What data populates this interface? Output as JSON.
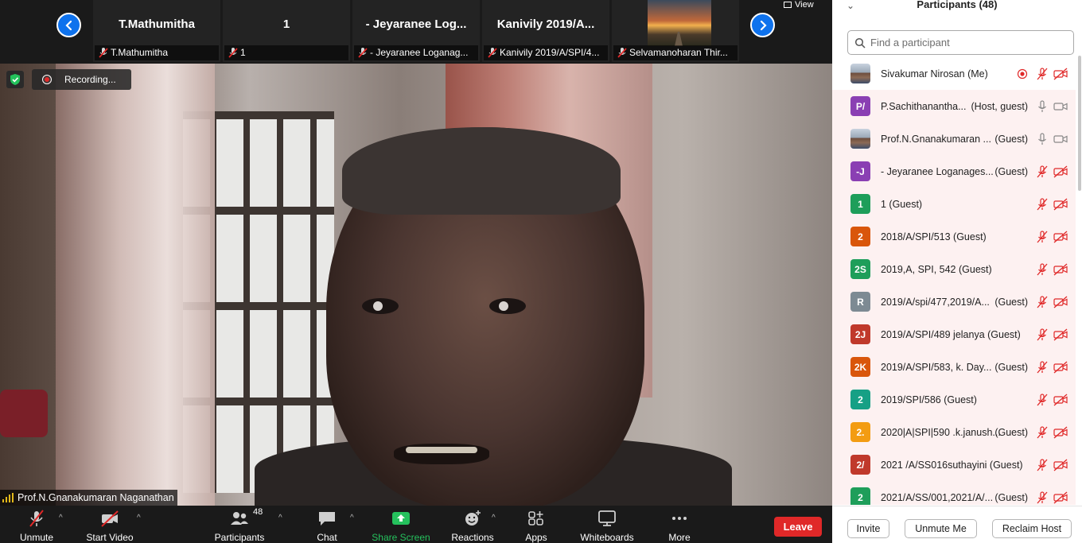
{
  "strip": {
    "tiles": [
      {
        "name": "T.Mathumitha",
        "label": "T.Mathumitha"
      },
      {
        "name": "1",
        "label": "1"
      },
      {
        "name": "- Jeyaranee Log...",
        "label": "- Jeyaranee Loganag..."
      },
      {
        "name": "Kanivily 2019/A...",
        "label": "Kanivily 2019/A/SPI/4..."
      },
      {
        "name": "",
        "label": "Selvamanoharan Thir..."
      }
    ],
    "view_label": "View"
  },
  "video": {
    "recording_label": "Recording...",
    "speaker_name": "Prof.N.Gnanakumaran Naganathan"
  },
  "toolbar": {
    "unmute": "Unmute",
    "start_video": "Start Video",
    "participants": "Participants",
    "participants_count": "48",
    "chat": "Chat",
    "share_screen": "Share Screen",
    "reactions": "Reactions",
    "apps": "Apps",
    "whiteboards": "Whiteboards",
    "more": "More",
    "leave": "Leave"
  },
  "panel": {
    "title": "Participants (48)",
    "search_placeholder": "Find a participant",
    "participants": [
      {
        "initials": "",
        "name": "Sivakumar Nirosan (Me)",
        "role": "",
        "color": "photo",
        "mic": "muted",
        "video": "off",
        "recording": true
      },
      {
        "initials": "P/",
        "name": "P.Sachithanantha...",
        "role": "(Host, guest)",
        "color": "#8a3fb3",
        "mic": "on",
        "video": "on"
      },
      {
        "initials": "",
        "name": "Prof.N.Gnanakumaran ...",
        "role": "(Guest)",
        "color": "photo",
        "mic": "on",
        "video": "on"
      },
      {
        "initials": "-J",
        "name": "- Jeyaranee Loganages...",
        "role": "(Guest)",
        "color": "#8a3fb3",
        "mic": "muted",
        "video": "off"
      },
      {
        "initials": "1",
        "name": "1 (Guest)",
        "role": "",
        "color": "#1e9e5a",
        "mic": "muted",
        "video": "off"
      },
      {
        "initials": "2",
        "name": "2018/A/SPI/513 (Guest)",
        "role": "",
        "color": "#d9560b",
        "mic": "muted",
        "video": "off"
      },
      {
        "initials": "2S",
        "name": "2019,A, SPI, 542 (Guest)",
        "role": "",
        "color": "#1e9e5a",
        "mic": "muted",
        "video": "off"
      },
      {
        "initials": "R",
        "name": "2019/A/spi/477,2019/A...",
        "role": "(Guest)",
        "color": "#7d8a93",
        "mic": "muted",
        "video": "off"
      },
      {
        "initials": "2J",
        "name": "2019/A/SPI/489 jelanya (Guest)",
        "role": "",
        "color": "#c0392b",
        "mic": "muted",
        "video": "off"
      },
      {
        "initials": "2K",
        "name": "2019/A/SPI/583, k. Day...",
        "role": "(Guest)",
        "color": "#d9560b",
        "mic": "muted",
        "video": "off"
      },
      {
        "initials": "2",
        "name": "2019/SPI/586 (Guest)",
        "role": "",
        "color": "#16a085",
        "mic": "muted",
        "video": "off"
      },
      {
        "initials": "2.",
        "name": "2020|A|SPI|590 .k.janush...",
        "role": "(Guest)",
        "color": "#f39c12",
        "mic": "muted",
        "video": "off"
      },
      {
        "initials": "2/",
        "name": "2021 /A/SS016suthayini (Guest)",
        "role": "",
        "color": "#c0392b",
        "mic": "muted",
        "video": "off"
      },
      {
        "initials": "2",
        "name": "2021/A/SS/001,2021/A/...",
        "role": "(Guest)",
        "color": "#1e9e5a",
        "mic": "muted",
        "video": "off"
      }
    ],
    "footer": {
      "invite": "Invite",
      "unmute_me": "Unmute Me",
      "reclaim_host": "Reclaim Host"
    }
  },
  "colors": {
    "accent_blue": "#0e72ed",
    "leave_red": "#e02828",
    "share_green": "#25c15d",
    "muted_red": "#e02828"
  }
}
